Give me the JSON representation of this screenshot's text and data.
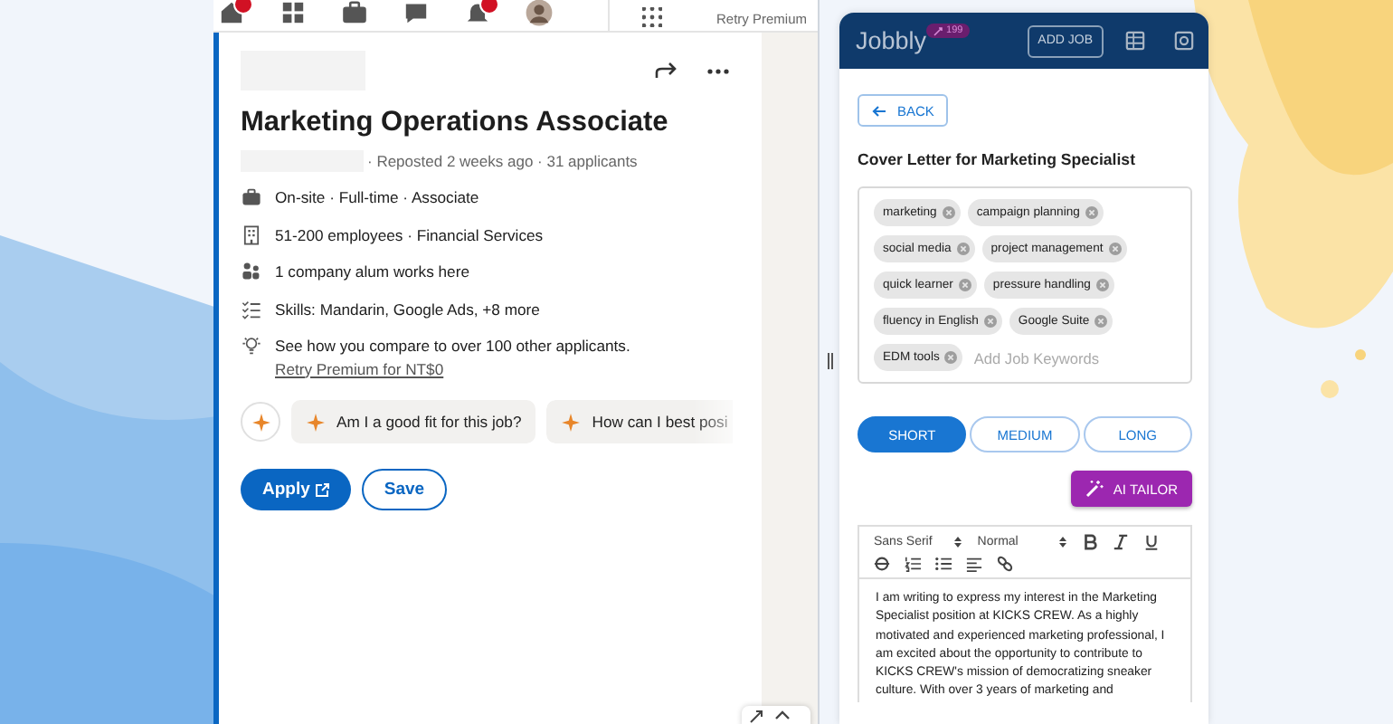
{
  "nav": {
    "items": [
      {
        "badge": true
      },
      {
        "badge": false
      },
      {
        "badge": false
      },
      {
        "badge": false
      },
      {
        "badge": true
      },
      {
        "badge": false
      }
    ],
    "premium_label": "Retry Premium"
  },
  "job": {
    "title": "Marketing Operations Associate",
    "meta": "· Reposted 2 weeks ago · 31 applicants",
    "insights": [
      {
        "text": "On-site · Full-time · Associate"
      },
      {
        "text": "51-200 employees · Financial Services"
      },
      {
        "text": "1 company alum works here"
      },
      {
        "text": "Skills: Mandarin, Google Ads, +8 more"
      },
      {
        "text": "See how you compare to over 100 other applicants.",
        "link": "Retry Premium for NT$0"
      }
    ],
    "prompts": [
      "Am I a good fit for this job?",
      "How can I best posi"
    ],
    "apply": "Apply",
    "save": "Save"
  },
  "jobbly": {
    "brand": "Jobbly",
    "badge": "199",
    "add_job": "ADD JOB",
    "back": "BACK",
    "heading": "Cover Letter for Marketing Specialist",
    "keywords": [
      "marketing",
      "campaign planning",
      "social media",
      "project management",
      "quick learner",
      "pressure handling",
      "fluency in English",
      "Google Suite",
      "EDM tools"
    ],
    "keyword_placeholder": "Add Job Keywords",
    "lengths": [
      {
        "label": "SHORT",
        "selected": true
      },
      {
        "label": "MEDIUM",
        "selected": false
      },
      {
        "label": "LONG",
        "selected": false
      }
    ],
    "tailor": "AI TAILOR",
    "editor": {
      "font": "Sans Serif",
      "size": "Normal",
      "text": "I am writing to express my interest in the Marketing Specialist position at KICKS CREW. As a highly motivated and experienced marketing professional, I am excited about the opportunity to contribute to KICKS CREW's mission of democratizing sneaker culture. With over 3 years of marketing and"
    }
  }
}
